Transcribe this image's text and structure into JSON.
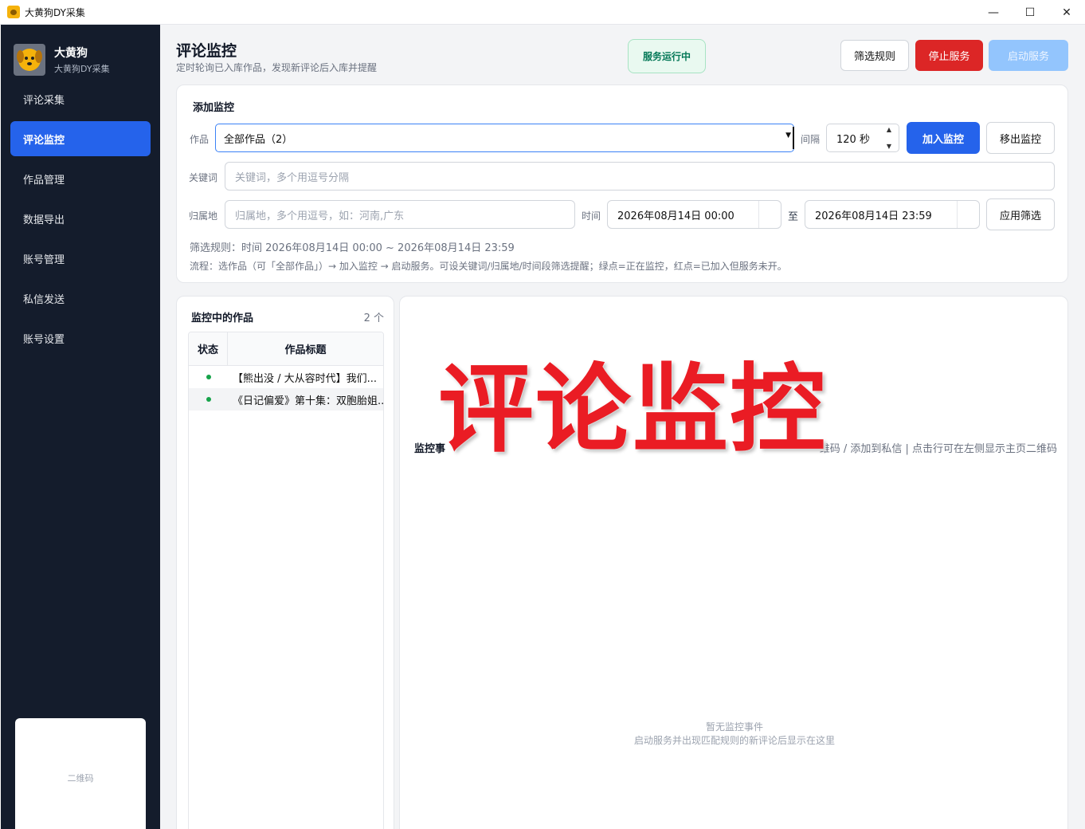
{
  "window": {
    "title": "大黄狗DY采集",
    "minimize": "—",
    "maximize": "☐",
    "close": "✕"
  },
  "sidebar": {
    "brand_name": "大黄狗",
    "brand_sub": "大黄狗DY采集",
    "items": [
      {
        "label": "评论采集",
        "active": false
      },
      {
        "label": "评论监控",
        "active": true
      },
      {
        "label": "作品管理",
        "active": false
      },
      {
        "label": "数据导出",
        "active": false
      },
      {
        "label": "账号管理",
        "active": false
      },
      {
        "label": "私信发送",
        "active": false
      },
      {
        "label": "账号设置",
        "active": false
      }
    ],
    "qr_placeholder": "二维码"
  },
  "header": {
    "title": "评论监控",
    "subtitle": "定时轮询已入库作品，发现新评论后入库并提醒",
    "status": "服务运行中",
    "btn_filter": "筛选规则",
    "btn_stop": "停止服务",
    "btn_start": "启动服务"
  },
  "add_monitor": {
    "title": "添加监控",
    "work_label": "作品",
    "work_value": "全部作品（2）",
    "interval_label": "间隔",
    "interval_value": "120 秒",
    "add_button": "加入监控",
    "remove_button": "移出监控",
    "keyword_label": "关键词",
    "keyword_placeholder": "关键词，多个用逗号分隔",
    "region_label": "归属地",
    "region_placeholder": "归属地，多个用逗号，如：河南,广东",
    "time_label": "时间",
    "time_start": "2026年08月14日 00:00",
    "time_to": "至",
    "time_end": "2026年08月14日 23:59",
    "apply_button": "应用筛选",
    "rule_text": "筛选规则：时间 2026年08月14日 00:00 ~ 2026年08月14日 23:59",
    "flow_text": "流程：选作品（可「全部作品」）→ 加入监控 → 启动服务。可设关键词/归属地/时间段筛选提醒；绿点=正在监控，红点=已加入但服务未开。"
  },
  "monitor_list": {
    "title": "监控中的作品",
    "count": "2 个",
    "col_status": "状态",
    "col_title": "作品标题",
    "rows": [
      {
        "status": "green",
        "title": "【熊出没 / 大从容时代】我们..."
      },
      {
        "status": "green",
        "title": "《日记偏爱》第十集：双胞胎姐..."
      }
    ]
  },
  "events": {
    "label": "监控事",
    "hint": "维码 / 添加到私信 | 点击行可在左侧显示主页二维码",
    "empty_title": "暂无监控事件",
    "empty_sub": "启动服务并出现匹配规则的新评论后显示在这里"
  },
  "overlay_text": "评论监控",
  "colors": {
    "sidebar_bg": "#141c2c",
    "accent": "#2563eb",
    "danger": "#dc2626",
    "success": "#16a34a",
    "overlay": "#ea1c24"
  }
}
